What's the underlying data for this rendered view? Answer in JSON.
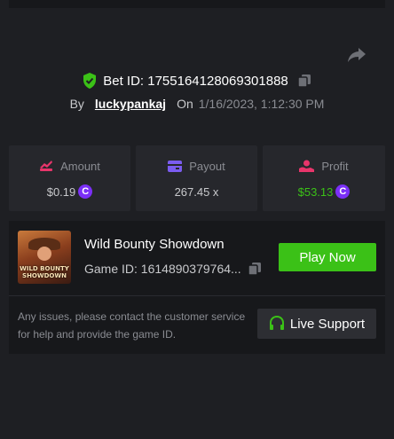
{
  "header": {
    "bet_id_label": "Bet ID: 1755164128069301888",
    "by_label": "By",
    "username": "luckypankaj",
    "on_label": "On",
    "date": "1/16/2023, 1:12:30 PM"
  },
  "stats": [
    {
      "label": "Amount",
      "value": "$0.19",
      "value_color": "#c8c9cc",
      "icon": "amount-icon"
    },
    {
      "label": "Payout",
      "value": "267.45 x",
      "value_color": "#c8c9cc",
      "icon": "payout-icon"
    },
    {
      "label": "Profit",
      "value": "$53.13",
      "value_color": "#3bc117",
      "icon": "profit-icon"
    }
  ],
  "coin_symbol": "C",
  "game": {
    "title": "Wild Bounty Showdown",
    "id_text": "Game ID: 1614890379764...",
    "thumb_text_line1": "WILD BOUNTY",
    "thumb_text_line2": "SHOWDOWN",
    "play_label": "Play Now"
  },
  "support": {
    "text": "Any issues, please contact the customer service for help and provide the game ID.",
    "button_label": "Live Support"
  },
  "colors": {
    "accent_green": "#3bc117",
    "coin_purple": "#7b2ff7",
    "shield_green": "#3bc117"
  }
}
